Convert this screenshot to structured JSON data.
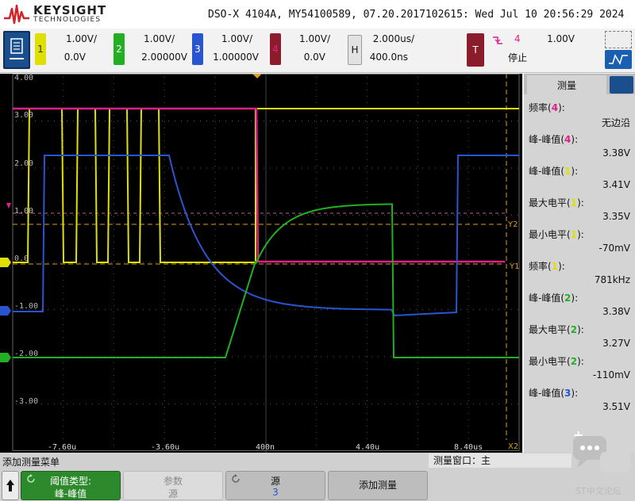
{
  "brand": {
    "name": "KEYSIGHT",
    "sub": "TECHNOLOGIES"
  },
  "title": "DSO-X 4104A, MY54100589, 07.20.2017102615: Wed Jul 10 20:56:29 2024",
  "channels": [
    {
      "num": "1",
      "scale": "1.00V/",
      "offset": "0.0V",
      "color": "#e0e000"
    },
    {
      "num": "2",
      "scale": "1.00V/",
      "offset": "2.00000V",
      "color": "#22b022"
    },
    {
      "num": "3",
      "scale": "1.00V/",
      "offset": "1.00000V",
      "color": "#2a55d0"
    },
    {
      "num": "4",
      "scale": "1.00V/",
      "offset": "0.0V",
      "color": "#e0208a"
    }
  ],
  "horizontal": {
    "label": "H",
    "scale": "2.000us/",
    "delay": "400.0ns"
  },
  "trigger": {
    "label": "T",
    "source": "4",
    "level": "1.00V",
    "status": "停止"
  },
  "scope": {
    "y_labels": [
      "4.00",
      "3.00",
      "2.00",
      "1.00",
      "0.0",
      "-1.00",
      "-2.00",
      "-3.00"
    ],
    "x_labels": [
      "-7.60u",
      "-3.60u",
      "400n",
      "4.40u",
      "8.40us"
    ],
    "cursors": [
      "Y2",
      "Y1",
      "X2"
    ],
    "colors": {
      "ch1": "#e0e000",
      "ch2": "#22b022",
      "ch3": "#2a55d0",
      "ch4": "#e0208a",
      "cursor": "#d9a020"
    }
  },
  "measure_panel": {
    "tab": "测量",
    "items": [
      {
        "name": "频率",
        "ch": "4",
        "value": "无边沿"
      },
      {
        "name": "峰-峰值",
        "ch": "4",
        "value": "3.38V"
      },
      {
        "name": "峰-峰值",
        "ch": "1",
        "value": "3.41V"
      },
      {
        "name": "最大电平",
        "ch": "1",
        "value": "3.35V"
      },
      {
        "name": "最小电平",
        "ch": "1",
        "value": "-70mV"
      },
      {
        "name": "频率",
        "ch": "1",
        "value": "781kHz"
      },
      {
        "name": "峰-峰值",
        "ch": "2",
        "value": "3.38V"
      },
      {
        "name": "最大电平",
        "ch": "2",
        "value": "3.27V"
      },
      {
        "name": "最小电平",
        "ch": "2",
        "value": "-110mV"
      },
      {
        "name": "峰-峰值",
        "ch": "3",
        "value": "3.51V"
      }
    ]
  },
  "bottom": {
    "menu_title": "添加测量菜单",
    "window_title": "测量窗口：主",
    "softkeys": {
      "threshold": {
        "l1": "阈值类型:",
        "l2": "峰-峰值"
      },
      "param": {
        "l1": "参数",
        "l2": "源"
      },
      "source": {
        "l1": "源",
        "l2": "3"
      },
      "add": "添加测量"
    }
  },
  "watermark": "ST中文论坛"
}
